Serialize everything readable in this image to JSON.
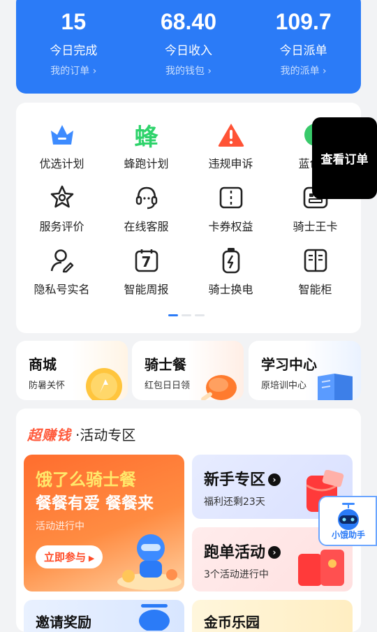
{
  "stats": [
    {
      "value": "15",
      "label": "今日完成",
      "link": "我的订单"
    },
    {
      "value": "68.40",
      "label": "今日收入",
      "link": "我的钱包"
    },
    {
      "value": "109.7",
      "label": "今日派单",
      "link": "我的派单"
    }
  ],
  "grid": [
    {
      "label": "优选计划",
      "icon": "crown-icon"
    },
    {
      "label": "蜂跑计划",
      "icon": "bee-icon",
      "glyph": "蜂"
    },
    {
      "label": "违规申诉",
      "icon": "warning-icon"
    },
    {
      "label": "蓝色风",
      "icon": "globe-icon"
    },
    {
      "label": "服务评价",
      "icon": "star-icon"
    },
    {
      "label": "在线客服",
      "icon": "headset-icon"
    },
    {
      "label": "卡券权益",
      "icon": "coupon-icon"
    },
    {
      "label": "骑士王卡",
      "icon": "card-icon"
    },
    {
      "label": "隐私号实名",
      "icon": "user-edit-icon"
    },
    {
      "label": "智能周报",
      "icon": "calendar-icon",
      "glyph": "7"
    },
    {
      "label": "骑士换电",
      "icon": "battery-icon"
    },
    {
      "label": "智能柜",
      "icon": "locker-icon"
    }
  ],
  "popup": {
    "label": "查看订单"
  },
  "promos": [
    {
      "title": "商城",
      "sub": "防暑关怀"
    },
    {
      "title": "骑士餐",
      "sub": "红包日日领"
    },
    {
      "title": "学习中心",
      "sub": "原培训中心"
    }
  ],
  "activity": {
    "brand": "超赚钱",
    "title": "·活动专区",
    "big": {
      "line1": "饿了么骑士餐",
      "line2": "餐餐有爱 餐餐来",
      "status": "活动进行中",
      "button": "立即参与"
    },
    "cards": [
      {
        "title": "新手专区",
        "sub": "福利还剩23天"
      },
      {
        "title": "跑单活动",
        "sub": "3个活动进行中"
      }
    ],
    "next": [
      {
        "title": "邀请奖励"
      },
      {
        "title": "金币乐园"
      }
    ]
  },
  "assistant": {
    "label": "小饿助手"
  },
  "colors": {
    "primary": "#2b7bf7",
    "accent": "#ff5a3c"
  }
}
